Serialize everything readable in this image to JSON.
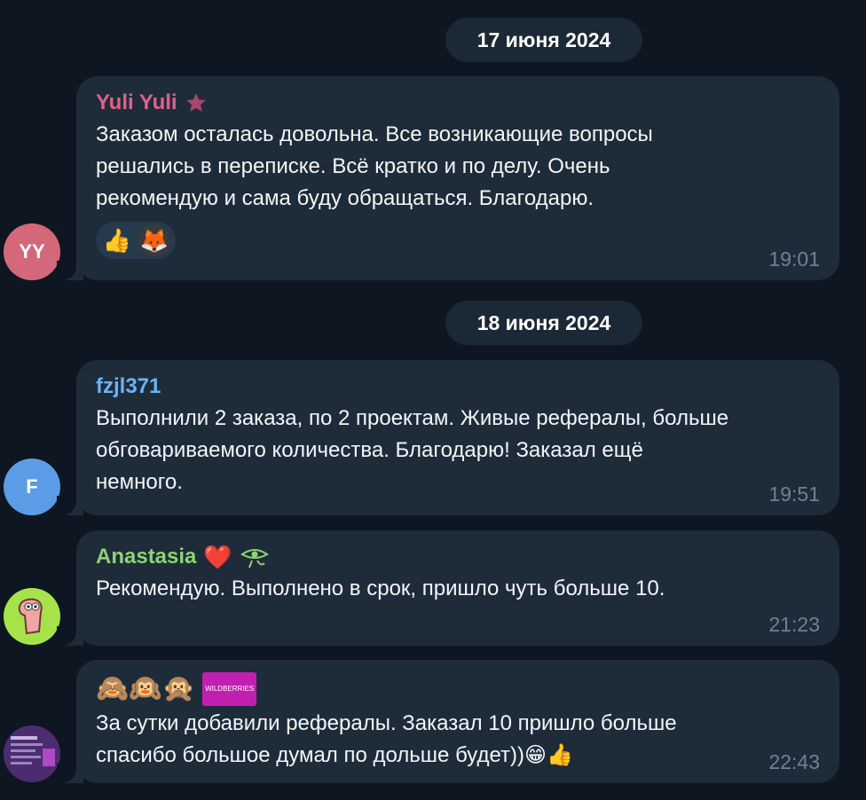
{
  "dates": [
    "17 июня 2024",
    "18 июня 2024"
  ],
  "messages": [
    {
      "sender": "Yuli Yuli",
      "sender_color": "#e35f8a",
      "avatar_initials": "YY",
      "avatar_color": "#d4687b",
      "text": "Заказом осталась довольна. Все возникающие вопросы\nрешались в переписке. Всё кратко и по делу. Очень\nрекомендую и сама буду обращаться. Благодарю.",
      "time": "19:01",
      "reactions": [
        "👍",
        "🦊"
      ]
    },
    {
      "sender": "fzjl371",
      "sender_color": "#6ab3f3",
      "avatar_initials": "F",
      "avatar_color": "#5c9ce6",
      "text": "Выполнили 2 заказа, по 2 проектам.  Живые рефералы, больше\nобговариваемого количества. Благодарю! Заказал ещё\nнемного.",
      "time": "19:51"
    },
    {
      "sender": "Anastasia",
      "sender_color": "#8ed272",
      "sender_emojis": "❤️",
      "text": "Рекомендую. Выполнено в срок, пришло чуть больше 10.",
      "time": "21:23"
    },
    {
      "header_emojis": "🙈🙉🙊",
      "header_badge": "WILDBERRIES",
      "text": "За сутки добавили рефералы.  Заказал 10 пришло больше\nспасибо большое думал по дольше будет))😁👍",
      "time": "22:43"
    }
  ]
}
